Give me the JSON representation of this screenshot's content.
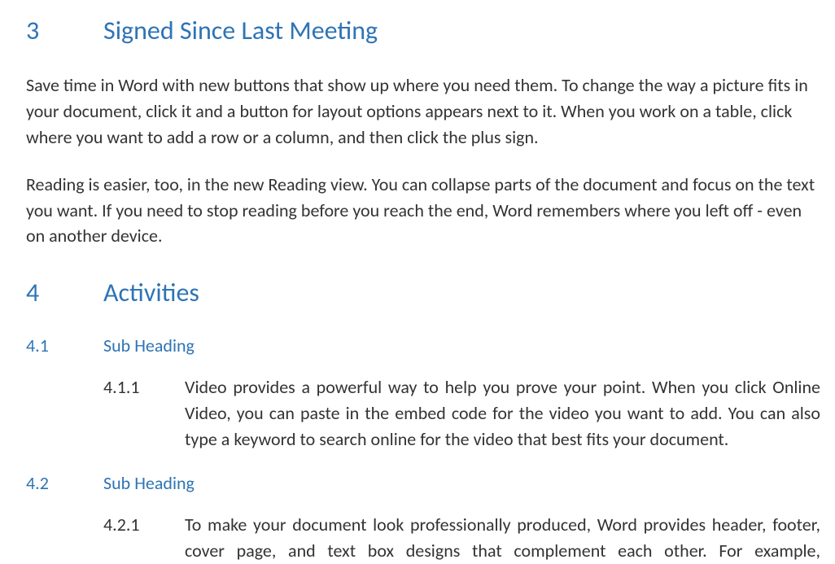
{
  "section3": {
    "number": "3",
    "title": "Signed Since Last Meeting",
    "paragraph1": "Save time in Word with new buttons that show up where you need them. To change the way a picture fits in your document, click it and a button for layout options appears next to it. When you work on a table, click where you want to add a row or a column, and then click the plus sign.",
    "paragraph2": "Reading is easier, too, in the new Reading view. You can collapse parts of the document and focus on the text you want. If you need to stop reading before you reach the end, Word remembers where you left off - even on another device."
  },
  "section4": {
    "number": "4",
    "title": "Activities",
    "sub1": {
      "number": "4.1",
      "title": "Sub Heading",
      "item1": {
        "number": "4.1.1",
        "text": "Video provides a powerful way to help you prove your point. When you click Online Video, you can paste in the embed code for the video you want to add. You can also type a keyword to search online for the video that best fits your document."
      }
    },
    "sub2": {
      "number": "4.2",
      "title": "Sub Heading",
      "item1": {
        "number": "4.2.1",
        "text": "To make your document look professionally produced, Word provides header, footer, cover page, and text box designs that complement each other. For example,"
      }
    }
  }
}
